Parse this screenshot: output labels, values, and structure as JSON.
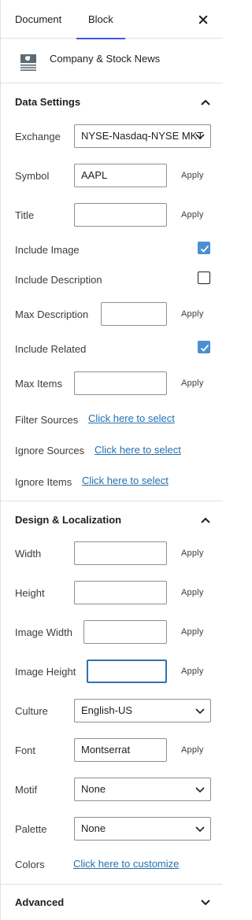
{
  "tabs": {
    "document": "Document",
    "block": "Block",
    "close_icon": "close-icon"
  },
  "block": {
    "name": "Company & Stock News",
    "icon": "stock-news-icon"
  },
  "data_settings": {
    "title": "Data Settings",
    "exchange": {
      "label": "Exchange",
      "value": "NYSE-Nasdaq-NYSE MKT"
    },
    "symbol": {
      "label": "Symbol",
      "value": "AAPL",
      "apply": "Apply"
    },
    "title_field": {
      "label": "Title",
      "value": "",
      "apply": "Apply"
    },
    "include_image": {
      "label": "Include Image",
      "checked": true
    },
    "include_description": {
      "label": "Include Description",
      "checked": false
    },
    "max_description": {
      "label": "Max Description",
      "value": "",
      "apply": "Apply"
    },
    "include_related": {
      "label": "Include Related",
      "checked": true
    },
    "max_items": {
      "label": "Max Items",
      "value": "",
      "apply": "Apply"
    },
    "filter_sources": {
      "label": "Filter Sources",
      "link": "Click here to select"
    },
    "ignore_sources": {
      "label": "Ignore Sources",
      "link": "Click here to select"
    },
    "ignore_items": {
      "label": "Ignore Items",
      "link": "Click here to select"
    }
  },
  "design": {
    "title": "Design & Localization",
    "width": {
      "label": "Width",
      "value": "",
      "apply": "Apply"
    },
    "height": {
      "label": "Height",
      "value": "",
      "apply": "Apply"
    },
    "image_width": {
      "label": "Image Width",
      "value": "",
      "apply": "Apply"
    },
    "image_height": {
      "label": "Image Height",
      "value": "",
      "apply": "Apply"
    },
    "culture": {
      "label": "Culture",
      "value": "English-US"
    },
    "font": {
      "label": "Font",
      "value": "Montserrat",
      "apply": "Apply"
    },
    "motif": {
      "label": "Motif",
      "value": "None"
    },
    "palette": {
      "label": "Palette",
      "value": "None"
    },
    "colors": {
      "label": "Colors",
      "link": "Click here to customize"
    }
  },
  "advanced": {
    "title": "Advanced"
  },
  "colors": {
    "accent": "#3858e9",
    "link": "#2271b1",
    "checkbox": "#4b8fd1",
    "focus": "#3171b4"
  }
}
